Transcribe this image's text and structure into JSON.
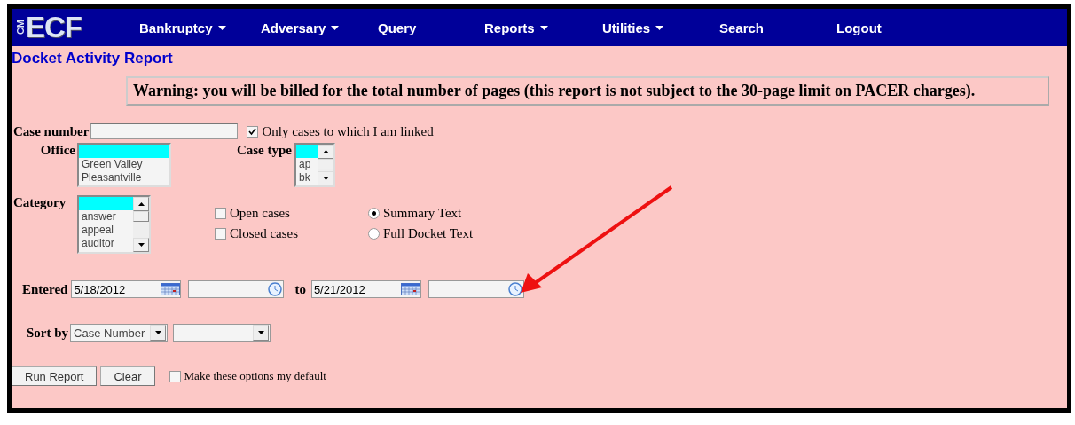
{
  "logo": {
    "prefix": "CM",
    "name": "ECF"
  },
  "menu": [
    {
      "label": "Bankruptcy",
      "dropdown": true
    },
    {
      "label": "Adversary",
      "dropdown": true
    },
    {
      "label": "Query",
      "dropdown": false
    },
    {
      "label": "Reports",
      "dropdown": true
    },
    {
      "label": "Utilities",
      "dropdown": true
    },
    {
      "label": "Search",
      "dropdown": false
    },
    {
      "label": "Logout",
      "dropdown": false
    }
  ],
  "page_title": "Docket Activity Report",
  "warning": "Warning: you will be billed for the total number of pages (this report is not subject to the 30-page limit on PACER charges).",
  "case_number": {
    "label": "Case number",
    "linked_only": {
      "label": "Only cases to which I am linked",
      "checked": true
    }
  },
  "office": {
    "label": "Office",
    "blank_selected": true,
    "options": [
      "Green Valley",
      "Pleasantville"
    ],
    "scrollbar": false
  },
  "case_type": {
    "label": "Case type",
    "blank_selected": true,
    "options": [
      "ap",
      "bk"
    ],
    "scrollbar": true
  },
  "category": {
    "label": "Category",
    "blank_selected": true,
    "options": [
      "answer",
      "appeal",
      "auditor"
    ],
    "scrollbar": true
  },
  "case_status": [
    {
      "label": "Open cases",
      "checked": false
    },
    {
      "label": "Closed cases",
      "checked": false
    }
  ],
  "text_type": [
    {
      "label": "Summary Text",
      "selected": true
    },
    {
      "label": "Full Docket Text",
      "selected": false
    }
  ],
  "entered": {
    "label": "Entered",
    "from_date": "5/18/2012",
    "to_label": "to",
    "to_date": "5/21/2012"
  },
  "sort": {
    "label": "Sort by",
    "first": "Case Number"
  },
  "buttons": [
    "Run Report",
    "Clear"
  ],
  "make_default": {
    "label": "Make these options my default",
    "checked": false
  },
  "annotation": {
    "kind": "arrow",
    "color": "#ee1111"
  }
}
